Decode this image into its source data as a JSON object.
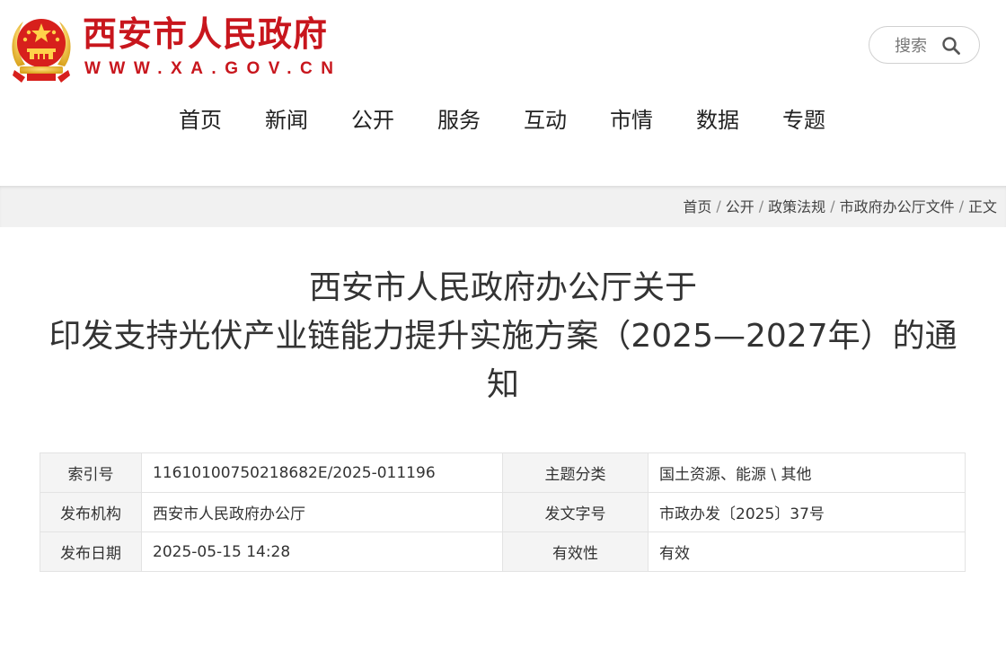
{
  "header": {
    "site_title": "西安市人民政府",
    "site_url": "WWW.XA.GOV.CN",
    "search_label": "搜索",
    "brand_color": "#c8161d"
  },
  "nav": {
    "items": [
      "首页",
      "新闻",
      "公开",
      "服务",
      "互动",
      "市情",
      "数据",
      "专题"
    ]
  },
  "breadcrumb": {
    "items": [
      "首页",
      "公开",
      "政策法规",
      "市政府办公厅文件",
      "正文"
    ],
    "separator": "/"
  },
  "document": {
    "title_lines": [
      "西安市人民政府办公厅关于",
      "印发支持光伏产业链能力提升实施方案（2025—2027年）的通",
      "知"
    ]
  },
  "meta": {
    "rows": [
      {
        "label_a": "索引号",
        "value_a": "11610100750218682E/2025-011196",
        "label_b": "主题分类",
        "value_b": "国土资源、能源 \\ 其他"
      },
      {
        "label_a": "发布机构",
        "value_a": "西安市人民政府办公厅",
        "label_b": "发文字号",
        "value_b": "市政办发〔2025〕37号"
      },
      {
        "label_a": "发布日期",
        "value_a": "2025-05-15 14:28",
        "label_b": "有效性",
        "value_b": "有效"
      }
    ]
  },
  "icons": {
    "logo": "national-emblem-icon",
    "search": "search-icon"
  }
}
